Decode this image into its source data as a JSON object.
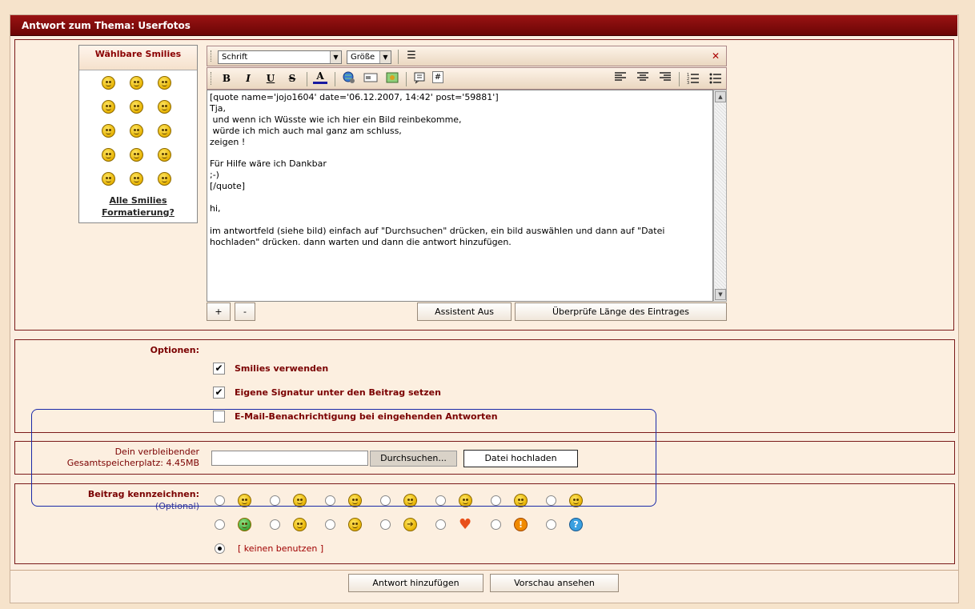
{
  "title": "Antwort zum Thema: Userfotos",
  "smilies": {
    "header": "Wählbare Smilies",
    "link_all": "Alle Smilies",
    "link_format": "Formatierung?"
  },
  "editor": {
    "font_select": "Schrift",
    "size_select": "Größe",
    "toolbar": {
      "bold": "B",
      "italic": "I",
      "underline": "U",
      "strike": "S",
      "font_color": "A"
    },
    "content": "[quote name='jojo1604' date='06.12.2007, 14:42' post='59881']\nTja,\n und wenn ich Wüsste wie ich hier ein Bild reinbekomme,\n würde ich mich auch mal ganz am schluss,\nzeigen !\n\nFür Hilfe wäre ich Dankbar\n;-)\n[/quote]\n\nhi,\n\nim antwortfeld (siehe bild) einfach auf \"Durchsuchen\" drücken, ein bild auswählen und dann auf \"Datei hochladen\" drücken. dann warten und dann die antwort hinzufügen.",
    "plus": "+",
    "minus": "-",
    "assistant": "Assistent Aus",
    "check_length": "Überprüfe Länge des Eintrages"
  },
  "options": {
    "label": "Optionen:",
    "items": [
      {
        "label": "Smilies verwenden",
        "checked": true
      },
      {
        "label": "Eigene Signatur unter den Beitrag setzen",
        "checked": true
      },
      {
        "label": "E-Mail-Benachrichtigung bei eingehenden Antworten",
        "checked": false
      }
    ]
  },
  "upload": {
    "label_line1": "Dein verbleibender",
    "label_line2": "Gesamtspeicherplatz: 4.45MB",
    "browse": "Durchsuchen...",
    "upload": "Datei hochladen"
  },
  "mark": {
    "label": "Beitrag kennzeichnen:",
    "optional": "(Optional)",
    "none": "[ keinen benutzen ]",
    "icons_row1": [
      "smile-icon",
      "sleepy-icon",
      "rolleyes-icon",
      "tongue-icon",
      "surprised-icon",
      "grin-icon",
      "angry-icon"
    ],
    "icons_row2": [
      "alien-icon",
      "neutral-icon",
      "glasses-icon",
      "arrow-icon",
      "heart-icon",
      "exclamation-icon",
      "question-icon"
    ]
  },
  "buttons": {
    "add_reply": "Antwort hinzufügen",
    "preview": "Vorschau ansehen"
  }
}
